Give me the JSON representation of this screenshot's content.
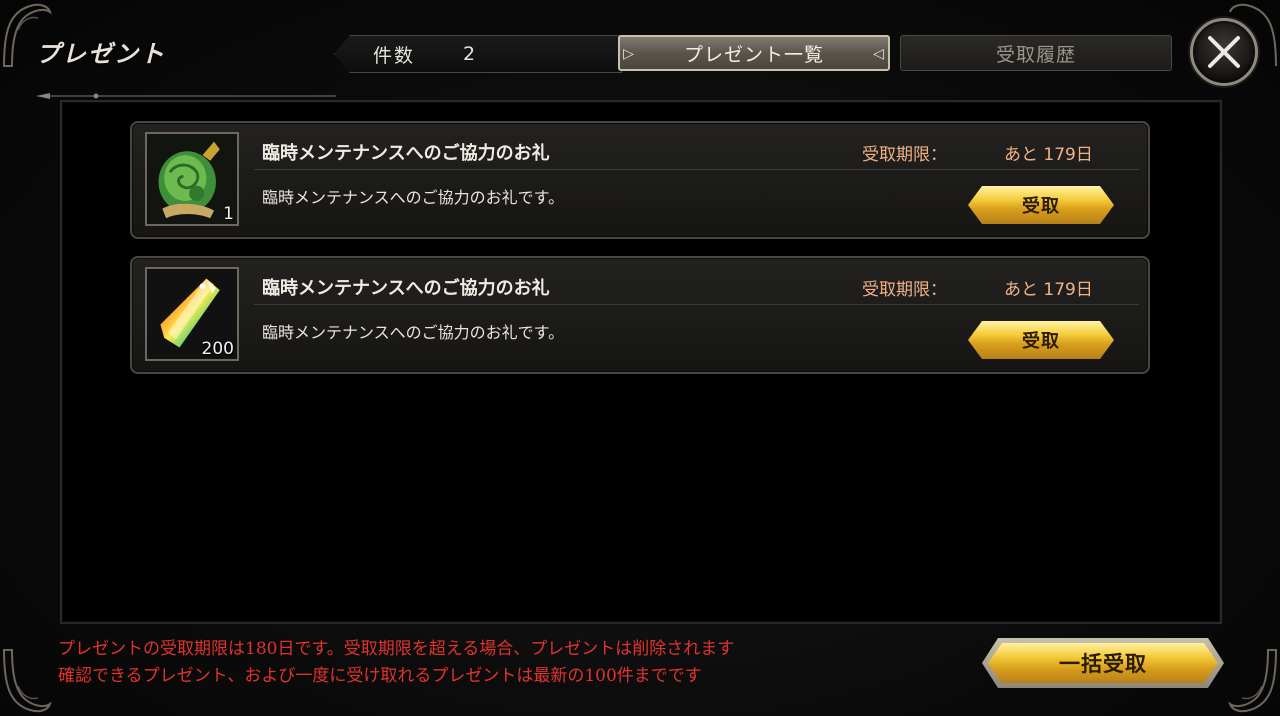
{
  "screen_title": "プレゼント",
  "count": {
    "label": "件数",
    "value": "2"
  },
  "tabs": [
    {
      "label": "プレゼント一覧",
      "active": true
    },
    {
      "label": "受取履歴",
      "active": false
    }
  ],
  "items": [
    {
      "icon": "green-scroll-icon",
      "quantity": "1",
      "title": "臨時メンテナンスへのご協力のお礼",
      "deadline_label": "受取期限：",
      "deadline_value": "あと 179日",
      "description": "臨時メンテナンスへのご協力のお礼です。",
      "button_label": "受取"
    },
    {
      "icon": "rainbow-crystal-icon",
      "quantity": "200",
      "title": "臨時メンテナンスへのご協力のお礼",
      "deadline_label": "受取期限：",
      "deadline_value": "あと 179日",
      "description": "臨時メンテナンスへのご協力のお礼です。",
      "button_label": "受取"
    }
  ],
  "notice": {
    "line1": "プレゼントの受取期限は180日です。受取期限を超える場合、プレゼントは削除されます",
    "line2": "確認できるプレゼント、および一度に受け取れるプレゼントは最新の100件までです"
  },
  "bulk_button_label": "一括受取",
  "colors": {
    "deadline": "#f0b285",
    "notice": "#e0332f",
    "gold": "#f4ca39"
  }
}
